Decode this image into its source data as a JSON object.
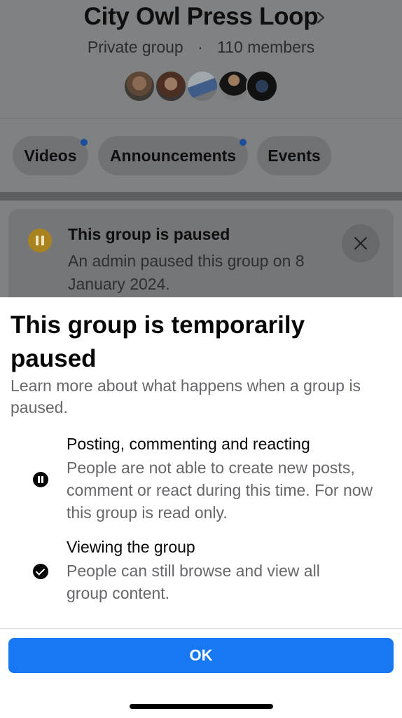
{
  "group": {
    "name": "City Owl Press Loop",
    "privacy": "Private group",
    "separator": "·",
    "members": "110 members"
  },
  "tabs": [
    {
      "label": "Videos",
      "has_badge": true
    },
    {
      "label": "Announcements",
      "has_badge": true
    },
    {
      "label": "Events",
      "has_badge": false
    }
  ],
  "notice": {
    "title": "This group is paused",
    "text": "An admin paused this group on 8 January 2024.",
    "icon": "pause-icon"
  },
  "sheet": {
    "title": "This group is temporarily paused",
    "subtitle": "Learn more about what happens when a group is paused.",
    "items": [
      {
        "icon": "pause-icon",
        "title": "Posting, commenting and reacting",
        "description": "People are not able to create new posts, comment or react during this time. For now this group is read only."
      },
      {
        "icon": "check-circle-icon",
        "title": "Viewing the group",
        "description": "People can still browse and view all group content."
      }
    ],
    "ok_label": "OK"
  },
  "colors": {
    "primary_button": "#1877f2",
    "paused_icon": "#a9831e",
    "tab_badge": "#1a4e9a"
  }
}
